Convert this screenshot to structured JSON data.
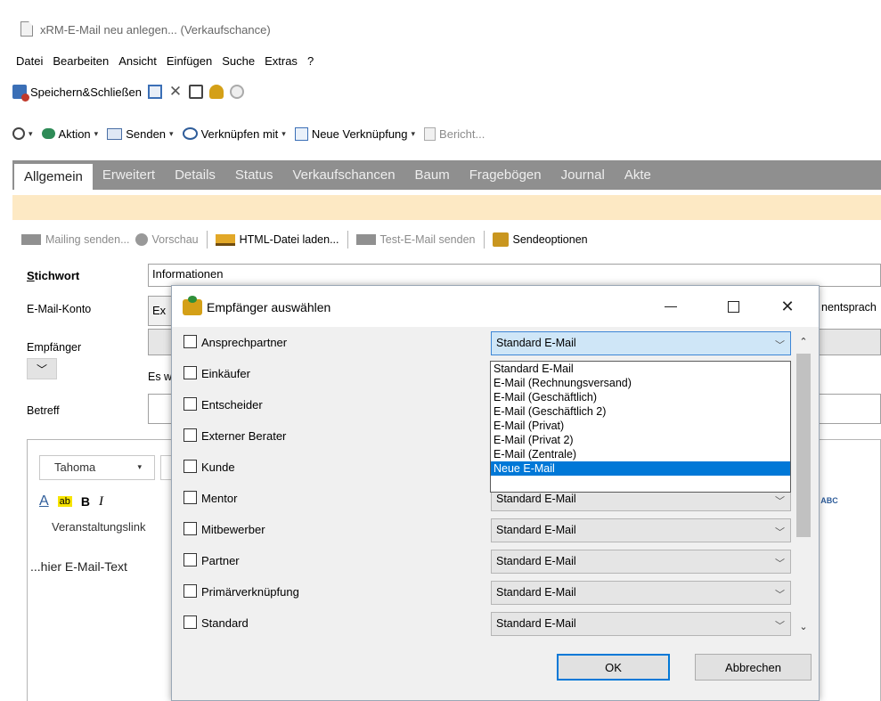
{
  "window": {
    "title": "xRM-E-Mail neu anlegen... (Verkaufschance)"
  },
  "menu": [
    "Datei",
    "Bearbeiten",
    "Ansicht",
    "Einfügen",
    "Suche",
    "Extras",
    "?"
  ],
  "toolbar1": {
    "save_close_label": "Speichern&Schließen",
    "delete_glyph": "✕"
  },
  "toolbar2": {
    "action_label": "Aktion",
    "send_label": "Senden",
    "link_label": "Verknüpfen mit",
    "new_link_label": "Neue Verknüpfung",
    "report_label": "Bericht..."
  },
  "tabs": [
    "Allgemein",
    "Erweitert",
    "Details",
    "Status",
    "Verkaufschancen",
    "Baum",
    "Fragebögen",
    "Journal",
    "Akte"
  ],
  "mailing_toolbar": {
    "send_mailing": "Mailing senden...",
    "preview": "Vorschau",
    "load_html": "HTML-Datei laden...",
    "test_mail": "Test-E-Mail senden",
    "send_options": "Sendeoptionen"
  },
  "form": {
    "stichwort_label_first": "S",
    "stichwort_label_rest": "tichwort",
    "stichwort_value": "Informationen",
    "konto_label": "E-Mail-Konto",
    "konto_value": "Ex",
    "konto_right": "nentsprach",
    "empfaenger_label": "Empfänger",
    "es_text": "Es w",
    "betreff_label": "Betreff"
  },
  "editor": {
    "font": "Tahoma",
    "format_a": "A",
    "format_highlight": "ab",
    "format_bold": "B",
    "format_italic": "I",
    "veranstaltung": "Veranstaltungslink",
    "body_text": "...hier E-Mail-Text",
    "spell_label": "ABC"
  },
  "dialog": {
    "title": "Empfänger auswählen",
    "close_glyph": "✕",
    "rows": [
      {
        "label": "Ansprechpartner",
        "value": "Standard E-Mail"
      },
      {
        "label": "Einkäufer",
        "value": ""
      },
      {
        "label": "Entscheider",
        "value": ""
      },
      {
        "label": "Externer Berater",
        "value": ""
      },
      {
        "label": "Kunde",
        "value": ""
      },
      {
        "label": "Mentor",
        "value": "Standard E-Mail"
      },
      {
        "label": "Mitbewerber",
        "value": "Standard E-Mail"
      },
      {
        "label": "Partner",
        "value": "Standard E-Mail"
      },
      {
        "label": "Primärverknüpfung",
        "value": "Standard E-Mail"
      },
      {
        "label": "Standard",
        "value": "Standard E-Mail"
      }
    ],
    "dropdown_options": [
      "Standard E-Mail",
      "E-Mail (Rechnungsversand)",
      "E-Mail (Geschäftlich)",
      "E-Mail (Geschäftlich 2)",
      "E-Mail (Privat)",
      "E-Mail (Privat 2)",
      "E-Mail (Zentrale)",
      "Neue E-Mail"
    ],
    "highlighted_option": "Neue E-Mail",
    "ok_label": "OK",
    "cancel_label": "Abbrechen"
  },
  "colors": {
    "tab_bar": "#8f8f8f",
    "notice": "#fde9c4",
    "selection": "#0078d7",
    "focus_select": "#cfe6f7"
  }
}
